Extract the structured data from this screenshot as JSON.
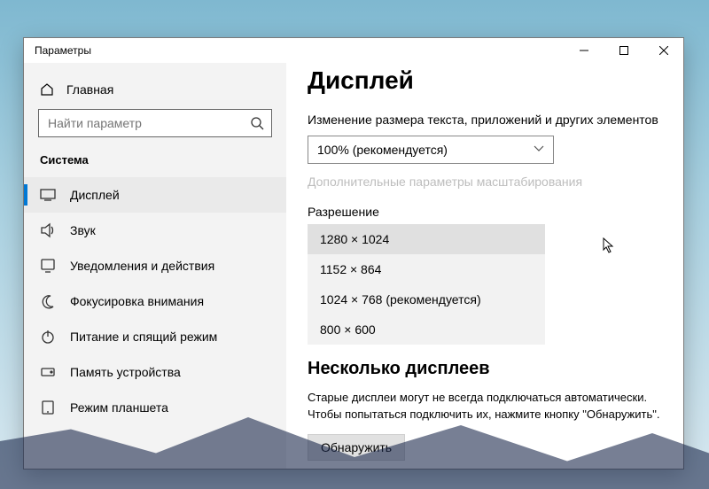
{
  "window": {
    "title": "Параметры"
  },
  "sidebar": {
    "home": "Главная",
    "search_placeholder": "Найти параметр",
    "section": "Система",
    "items": [
      {
        "label": "Дисплей"
      },
      {
        "label": "Звук"
      },
      {
        "label": "Уведомления и действия"
      },
      {
        "label": "Фокусировка внимания"
      },
      {
        "label": "Питание и спящий режим"
      },
      {
        "label": "Память устройства"
      },
      {
        "label": "Режим планшета"
      }
    ]
  },
  "main": {
    "title": "Дисплей",
    "scale_label": "Изменение размера текста, приложений и других элементов",
    "scale_value": "100% (рекомендуется)",
    "advanced_scaling": "Дополнительные параметры масштабирования",
    "resolution_label": "Разрешение",
    "resolutions": [
      "1280 × 1024",
      "1152 × 864",
      "1024 × 768 (рекомендуется)",
      "800 × 600"
    ],
    "multi_title": "Несколько дисплеев",
    "multi_desc": "Старые дисплеи могут не всегда подключаться автоматически. Чтобы попытаться подключить их, нажмите кнопку \"Обнаружить\".",
    "detect_btn": "Обнаружить"
  }
}
